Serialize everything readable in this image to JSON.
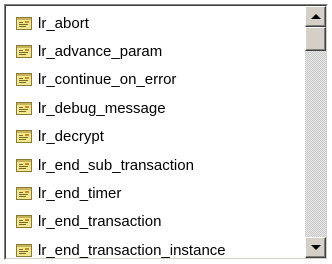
{
  "listbox": {
    "items": [
      {
        "label": "lr_abort",
        "icon": "function-icon"
      },
      {
        "label": "lr_advance_param",
        "icon": "function-icon"
      },
      {
        "label": "lr_continue_on_error",
        "icon": "function-icon"
      },
      {
        "label": "lr_debug_message",
        "icon": "function-icon"
      },
      {
        "label": "lr_decrypt",
        "icon": "function-icon"
      },
      {
        "label": "lr_end_sub_transaction",
        "icon": "function-icon"
      },
      {
        "label": "lr_end_timer",
        "icon": "function-icon"
      },
      {
        "label": "lr_end_transaction",
        "icon": "function-icon"
      },
      {
        "label": "lr_end_transaction_instance",
        "icon": "function-icon"
      }
    ],
    "scrollbar": {
      "up_icon": "arrow-up-icon",
      "down_icon": "arrow-down-icon",
      "scroll_position": 0
    }
  }
}
